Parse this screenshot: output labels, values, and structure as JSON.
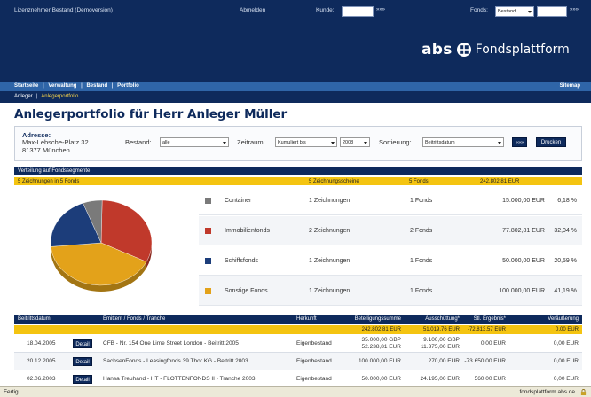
{
  "topbar": {
    "license": "Lizenznehmer Bestand (Demoversion)",
    "logout": "Abmelden",
    "kunde_label": "Kunde:",
    "kunde_value": "",
    "go": "»»»",
    "fonds_label": "Fonds:",
    "fonds_select": "Bestand",
    "fonds_value": ""
  },
  "logo": {
    "abs": "abs",
    "text": "Fondsplattform"
  },
  "nav": {
    "items": [
      "Startseite",
      "Verwaltung",
      "Bestand",
      "Portfolio"
    ],
    "separator": "|",
    "sitemap": "Sitemap"
  },
  "subnav": {
    "items": [
      "Anleger",
      "Anlegerportfolio"
    ],
    "separator": "|"
  },
  "page": {
    "title": "Anlegerportfolio für Herr   Anleger Müller"
  },
  "filter": {
    "address_label": "Adresse:",
    "address_line1": "Max-Lebsche-Platz 32",
    "address_line2": "81377 München",
    "bestand_label": "Bestand:",
    "bestand_value": "alle",
    "zeitraum_label": "Zeitraum:",
    "zeitraum_value": "Kumuliert bis",
    "jahr_value": "2008",
    "sortierung_label": "Sortierung:",
    "sortierung_value": "Beitrittsdatum",
    "go_label": "»»»",
    "print_label": "Drucken"
  },
  "segments": {
    "header": "Verteilung auf Fondssegmente",
    "summary": {
      "zeichnungen": "5 Zeichnungen in 5 Fonds",
      "scheine": "5 Zeichnungsscheine",
      "fonds": "5 Fonds",
      "betrag": "242.802,81 EUR"
    },
    "rows": [
      {
        "name": "Container",
        "zeichnungen": "1 Zeichnungen",
        "fonds": "1 Fonds",
        "betrag": "15.000,00 EUR",
        "prozent": "6,18 %",
        "color": "#7a7a7a"
      },
      {
        "name": "Immobilienfonds",
        "zeichnungen": "2 Zeichnungen",
        "fonds": "2 Fonds",
        "betrag": "77.802,81 EUR",
        "prozent": "32,04 %",
        "color": "#c0392b"
      },
      {
        "name": "Schiffsfonds",
        "zeichnungen": "1 Zeichnungen",
        "fonds": "1 Fonds",
        "betrag": "50.000,00 EUR",
        "prozent": "20,59 %",
        "color": "#1c3d7a"
      },
      {
        "name": "Sonstige Fonds",
        "zeichnungen": "1 Zeichnungen",
        "fonds": "1 Fonds",
        "betrag": "100.000,00 EUR",
        "prozent": "41,19 %",
        "color": "#e3a21a"
      }
    ]
  },
  "chart_data": {
    "type": "pie",
    "categories": [
      "Container",
      "Immobilienfonds",
      "Schiffsfonds",
      "Sonstige Fonds"
    ],
    "values": [
      6.18,
      32.04,
      20.59,
      41.19
    ],
    "colors": [
      "#7a7a7a",
      "#c0392b",
      "#1c3d7a",
      "#e3a21a"
    ]
  },
  "transactions": {
    "headers": {
      "date": "Beitrittsdatum",
      "emittent": "Emittent / Fonds / Tranche",
      "herkunft": "Herkunft",
      "summe": "Beteiligungssumme",
      "ausschuettung": "Ausschüttung*",
      "ergebnis": "Stl. Ergebnis*",
      "veraeusserung": "Veräußerung"
    },
    "sum": {
      "summe": "242.802,81 EUR",
      "ausschuettung": "51.019,76 EUR",
      "ergebnis": "-72.813,57 EUR",
      "veraeusserung": "0,00 EUR"
    },
    "detail_label": "Detail",
    "rows": [
      {
        "date": "18.04.2005",
        "emittent": "CFB - Nr. 154 One Lime Street London - Beitritt 2005",
        "herkunft": "Eigenbestand",
        "summe": "35.000,00 GBP\n52.238,81 EUR",
        "ausschuettung": "9.100,00 GBP\n11.375,00 EUR",
        "ergebnis": "0,00 EUR",
        "veraeusserung": "0,00 EUR"
      },
      {
        "date": "20.12.2005",
        "emittent": "SachsenFonds - Leasingfonds 39 Thor KG - Beitritt 2003",
        "herkunft": "Eigenbestand",
        "summe": "100.000,00 EUR",
        "ausschuettung": "270,00 EUR",
        "ergebnis": "-73.650,00 EUR",
        "veraeusserung": "0,00 EUR"
      },
      {
        "date": "02.06.2003",
        "emittent": "Hansa Treuhand - HT - FLOTTENFONDS II - Tranche 2003",
        "herkunft": "Eigenbestand",
        "summe": "50.000,00 EUR",
        "ausschuettung": "24.195,00 EUR",
        "ergebnis": "560,00 EUR",
        "veraeusserung": "0,00 EUR"
      }
    ]
  },
  "status": {
    "left": "Fertig",
    "right": "fondsplattform.abs.de"
  }
}
